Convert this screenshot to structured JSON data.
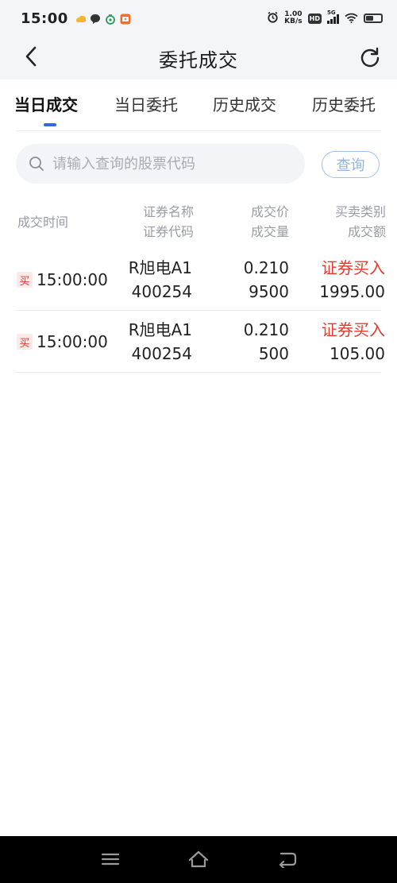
{
  "status_bar": {
    "time": "15:00",
    "speed_value": "1.00",
    "speed_unit": "KB/s",
    "hd_label": "HD",
    "network_label": "5G"
  },
  "nav": {
    "title": "委托成交"
  },
  "tabs": [
    {
      "label": "当日成交",
      "active": true
    },
    {
      "label": "当日委托",
      "active": false
    },
    {
      "label": "历史成交",
      "active": false
    },
    {
      "label": "历史委托",
      "active": false
    }
  ],
  "search": {
    "placeholder": "请输入查询的股票代码",
    "value": "",
    "button_label": "查询"
  },
  "table": {
    "headers": {
      "time": "成交时间",
      "name": "证券名称",
      "code": "证券代码",
      "price": "成交价",
      "quantity": "成交量",
      "type": "买卖类别",
      "amount": "成交额"
    },
    "rows": [
      {
        "badge": "买",
        "time": "15:00:00",
        "name": "R旭电A1",
        "code": "400254",
        "price": "0.210",
        "quantity": "9500",
        "type": "证券买入",
        "amount": "1995.00"
      },
      {
        "badge": "买",
        "time": "15:00:00",
        "name": "R旭电A1",
        "code": "400254",
        "price": "0.210",
        "quantity": "500",
        "type": "证券买入",
        "amount": "105.00"
      }
    ]
  },
  "colors": {
    "accent": "#2f6ae0",
    "buy_red": "#e33b2e",
    "header_bg": "#f4f5f9",
    "muted_text": "#9a9ca3"
  },
  "icons": {
    "back": "chevron-left-icon",
    "refresh": "refresh-icon",
    "search": "search-icon",
    "menu": "menu-icon",
    "home": "home-icon",
    "back_system": "back-arrow-icon"
  }
}
